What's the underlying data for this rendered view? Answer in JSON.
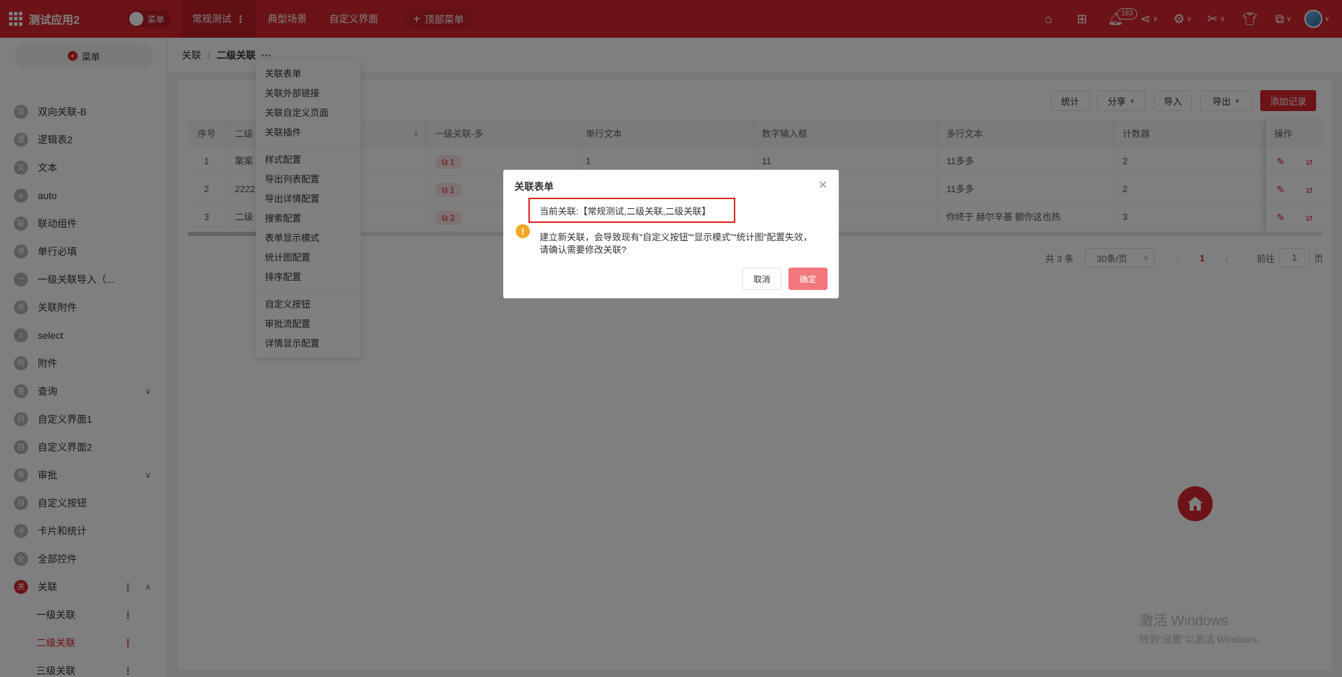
{
  "app": {
    "title": "测试应用2",
    "menu_toggle": "菜单"
  },
  "topnav": {
    "items": [
      "常规测试",
      "典型场景",
      "自定义界面"
    ],
    "add_label": "顶部菜单",
    "notification_count": "183"
  },
  "sidebar": {
    "menu_button": "菜单",
    "items": [
      {
        "icon": "双",
        "label": "双向关联-B"
      },
      {
        "icon": "逻",
        "label": "逻辑表2"
      },
      {
        "icon": "文",
        "label": "文本"
      },
      {
        "icon": "a",
        "label": "auto"
      },
      {
        "icon": "联",
        "label": "联动组件"
      },
      {
        "icon": "单",
        "label": "单行必填"
      },
      {
        "icon": "一",
        "label": "一级关联导入（..."
      },
      {
        "icon": "关",
        "label": "关联附件"
      },
      {
        "icon": "s",
        "label": "select"
      },
      {
        "icon": "附",
        "label": "附件"
      },
      {
        "icon": "查",
        "label": "查询"
      },
      {
        "icon": "自",
        "label": "自定义界面1"
      },
      {
        "icon": "自",
        "label": "自定义界面2"
      },
      {
        "icon": "审",
        "label": "审批"
      },
      {
        "icon": "自",
        "label": "自定义按钮"
      },
      {
        "icon": "卡",
        "label": "卡片和统计"
      },
      {
        "icon": "全",
        "label": "全部控件"
      },
      {
        "icon": "关",
        "label": "关联"
      }
    ],
    "sub_items": [
      "一级关联",
      "二级关联",
      "三级关联"
    ]
  },
  "breadcrumb": {
    "parent": "关联",
    "current": "二级关联"
  },
  "dropdown": {
    "group1": [
      "关联表单",
      "关联外部链接",
      "关联自定义页面",
      "关联插件"
    ],
    "group2": [
      "样式配置",
      "导出列表配置",
      "导出详情配置",
      "搜索配置",
      "表单显示模式",
      "统计图配置",
      "排序配置"
    ],
    "group3": [
      "自定义按钮",
      "审批流配置",
      "详情显示配置"
    ]
  },
  "toolbar": {
    "stats": "统计",
    "share": "分享",
    "import": "导入",
    "export": "导出",
    "add": "添加记录"
  },
  "table": {
    "headers": [
      "序号",
      "二级",
      "一级关联-多",
      "单行文本",
      "数字输入框",
      "多行文本",
      "计数器",
      "操作"
    ],
    "rows": [
      {
        "no": "1",
        "c2": "案案",
        "tag": "1",
        "text": "1",
        "num": "11",
        "multi": "11多多",
        "counter": "2"
      },
      {
        "no": "2",
        "c2": "2222",
        "tag": "1",
        "text": "",
        "num": "",
        "multi": "11多多",
        "counter": "2"
      },
      {
        "no": "3",
        "c2": "二级",
        "tag": "2",
        "text": "",
        "num": "",
        "multi": "你终于 赫尔辛基 额你这也热",
        "counter": "3"
      }
    ]
  },
  "pager": {
    "total": "共 3 条",
    "page_size": "30条/页",
    "current": "1",
    "goto": "前往",
    "goto_value": "1",
    "page_unit": "页"
  },
  "dialog": {
    "title": "关联表单",
    "current": "当前关联:【常规测试,二级关联,二级关联】",
    "message": "建立新关联，会导致现有“自定义按钮”“显示模式”“统计图”配置失效，请确认需要修改关联?",
    "cancel": "取消",
    "ok": "确定"
  },
  "watermark": {
    "line1": "激活 Windows",
    "line2": "转到“设置”以激活 Windows。"
  },
  "colors": {
    "brand": "#d9262f",
    "confirm": "#f2787c",
    "warn": "#f5a623"
  }
}
